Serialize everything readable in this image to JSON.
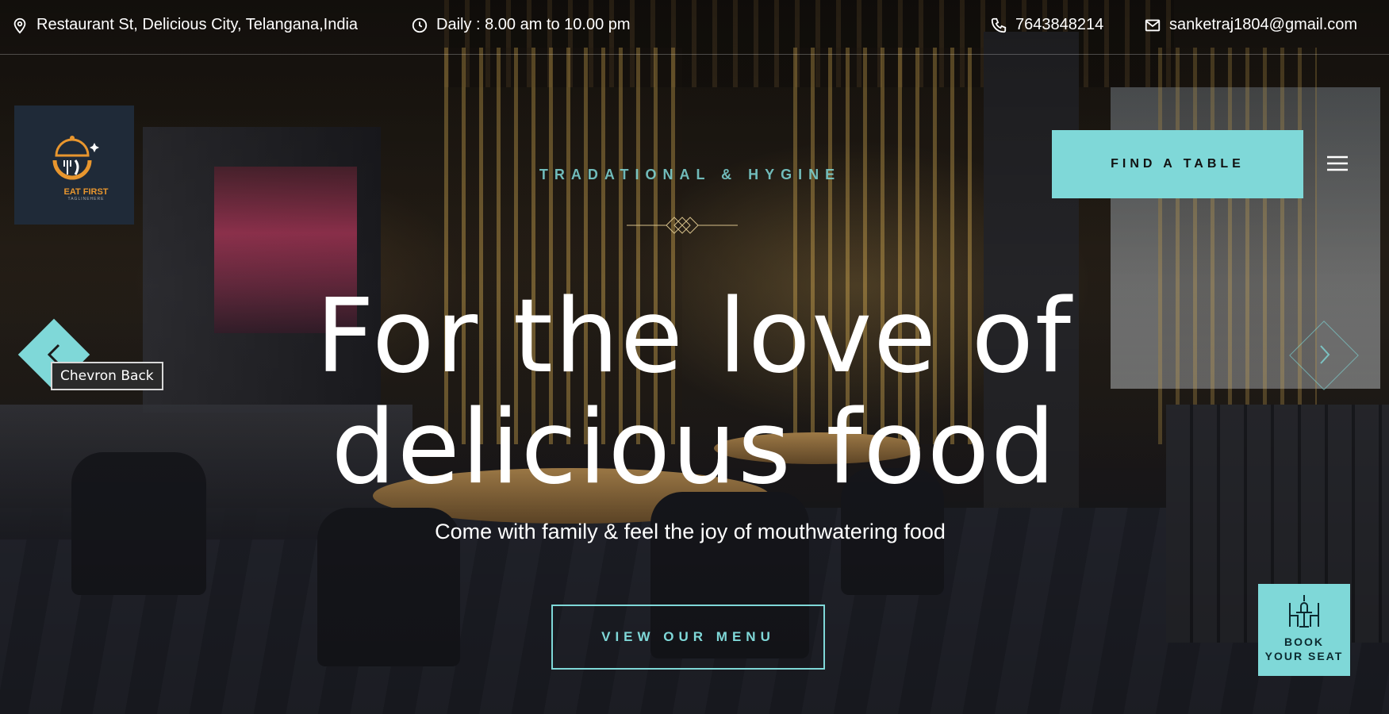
{
  "topbar": {
    "address": "Restaurant St, Delicious City, Telangana,India",
    "hours": "Daily : 8.00 am to 10.00 pm",
    "phone": "7643848214",
    "email": "sanketraj1804@gmail.com",
    "icons": [
      "location-pin-icon",
      "clock-icon",
      "phone-icon",
      "mail-icon"
    ]
  },
  "logo": {
    "brand": "EAT FIRST",
    "tagline": "TAGLINEHERE"
  },
  "header": {
    "find_table_label": "FIND A TABLE"
  },
  "hero": {
    "eyebrow": "TRADATIONAL & HYGINE",
    "headline": "For the love of delicious food",
    "subline": "Come with family & feel the joy of mouthwatering food",
    "cta_label": "VIEW OUR MENU"
  },
  "slider": {
    "prev_tooltip": "Chevron Back"
  },
  "book_seat": {
    "line1": "BOOK",
    "line2": "YOUR SEAT"
  },
  "colors": {
    "accent": "#7fd8d8",
    "logo_bg": "#1f2a38",
    "logo_orange": "#e8962e"
  }
}
